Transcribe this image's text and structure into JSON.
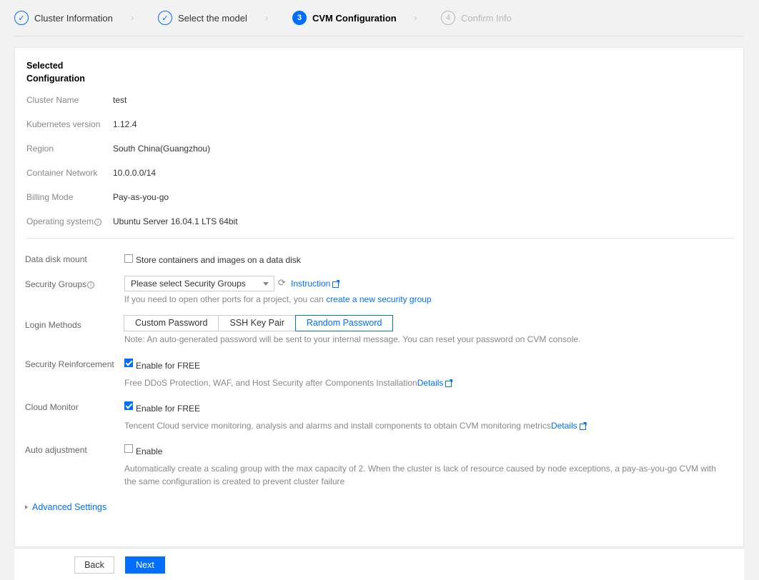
{
  "steps": [
    {
      "num": "✓",
      "label": "Cluster Information",
      "state": "done"
    },
    {
      "num": "✓",
      "label": "Select the model",
      "state": "done"
    },
    {
      "num": "3",
      "label": "CVM Configuration",
      "state": "active"
    },
    {
      "num": "4",
      "label": "Confirm Info",
      "state": "pending"
    }
  ],
  "selected": {
    "title": "Selected Configuration",
    "rows": [
      {
        "key": "Cluster Name",
        "value": "test"
      },
      {
        "key": "Kubernetes version",
        "value": "1.12.4"
      },
      {
        "key": "Region",
        "value": "South China(Guangzhou)"
      },
      {
        "key": "Container Network",
        "value": "10.0.0.0/14"
      },
      {
        "key": "Billing Mode",
        "value": "Pay-as-you-go"
      },
      {
        "key": "Operating system",
        "value": "Ubuntu Server 16.04.1 LTS 64bit"
      }
    ]
  },
  "form": {
    "data_disk": {
      "label": "Data disk mount",
      "checkbox": "Store containers and images on a data disk",
      "checked": false
    },
    "security_groups": {
      "label": "Security Groups",
      "select_value": "Please select Security Groups",
      "instruction": "Instruction",
      "hint_prefix": "If you need to open other ports for a project, you can ",
      "hint_link": "create a new security group"
    },
    "login": {
      "label": "Login Methods",
      "options": [
        "Custom Password",
        "SSH Key Pair",
        "Random Password"
      ],
      "selected": "Random Password",
      "note": "Note: An auto-generated password will be sent to your internal message. You can reset your password on CVM console."
    },
    "security_reinforcement": {
      "label": "Security Reinforcement",
      "checkbox": "Enable for FREE",
      "checked": true,
      "hint": "Free DDoS Protection, WAF, and Host Security after Components Installation",
      "details": "Details"
    },
    "cloud_monitor": {
      "label": "Cloud Monitor",
      "checkbox": "Enable for FREE",
      "checked": true,
      "hint": "Tencent Cloud service monitoring, analysis and alarms and install components to obtain CVM monitoring metrics",
      "details": "Details"
    },
    "auto_adjustment": {
      "label": "Auto adjustment",
      "checkbox": "Enable",
      "checked": false,
      "hint_line1": "Automatically create a scaling group with the max capacity of 2. When the cluster is lack of resource caused by node exceptions, a pay-as-you-go CVM with",
      "hint_line2": "the same configuration is created to prevent cluster failure"
    },
    "advanced": "Advanced Settings"
  },
  "footer": {
    "back": "Back",
    "next": "Next"
  },
  "colors": {
    "accent": "#006eff"
  }
}
